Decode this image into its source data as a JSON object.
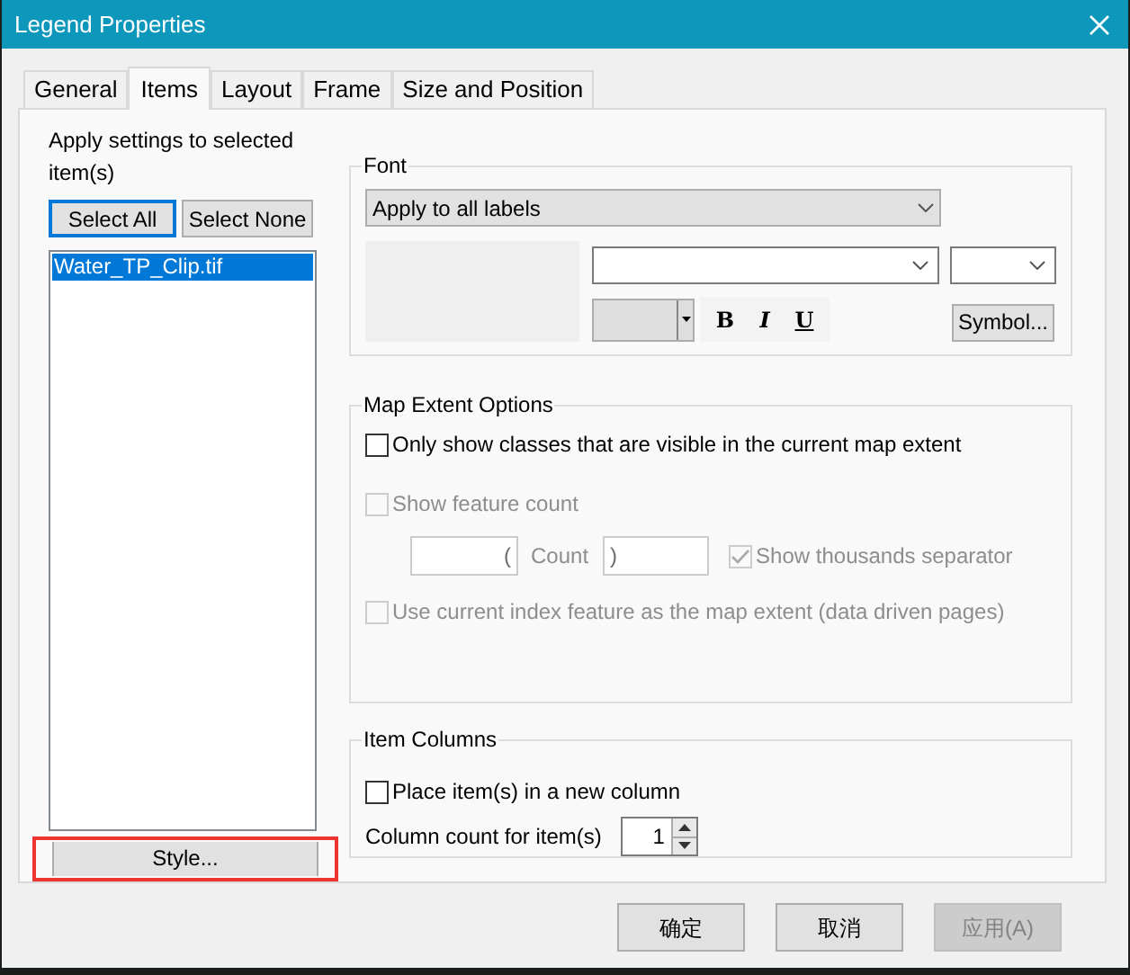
{
  "window": {
    "title": "Legend Properties"
  },
  "tabs": [
    {
      "label": "General",
      "selected": false
    },
    {
      "label": "Items",
      "selected": true
    },
    {
      "label": "Layout",
      "selected": false
    },
    {
      "label": "Frame",
      "selected": false
    },
    {
      "label": "Size and Position",
      "selected": false
    }
  ],
  "items_panel": {
    "caption": "Apply settings to selected item(s)",
    "buttons": [
      {
        "label": "Select All",
        "focused": true
      },
      {
        "label": "Select None",
        "focused": false
      }
    ],
    "items": [
      {
        "label": "Water_TP_Clip.tif",
        "selected": true
      }
    ],
    "style_button": {
      "label": "Style...",
      "highlighted": true
    }
  },
  "font": {
    "title": "Font",
    "apply_to": "Apply to all labels",
    "style_buttons": [
      "B",
      "I",
      "U"
    ],
    "symbol_button": "Symbol..."
  },
  "map_extent": {
    "title": "Map Extent Options",
    "visible_only": {
      "label": "Only show classes that are visible in the current map extent",
      "checked": false,
      "disabled": false
    },
    "feature_count": {
      "label": "Show feature count",
      "checked": false,
      "disabled": true
    },
    "prefix": "(",
    "count_label": "Count",
    "suffix": ")",
    "thousands": {
      "label": "Show thousands separator",
      "checked": true,
      "disabled": true
    },
    "index_extent": {
      "label": "Use current index feature as the map extent (data driven pages)",
      "checked": false,
      "disabled": true
    }
  },
  "item_columns": {
    "title": "Item Columns",
    "new_column": {
      "label": "Place item(s) in a new column",
      "checked": false,
      "disabled": false
    },
    "count_label": "Column count for item(s)",
    "count": "1"
  },
  "buttons": [
    {
      "label": "确定",
      "disabled": false
    },
    {
      "label": "取消",
      "disabled": false
    },
    {
      "label": "应用(A)",
      "disabled": true
    }
  ]
}
